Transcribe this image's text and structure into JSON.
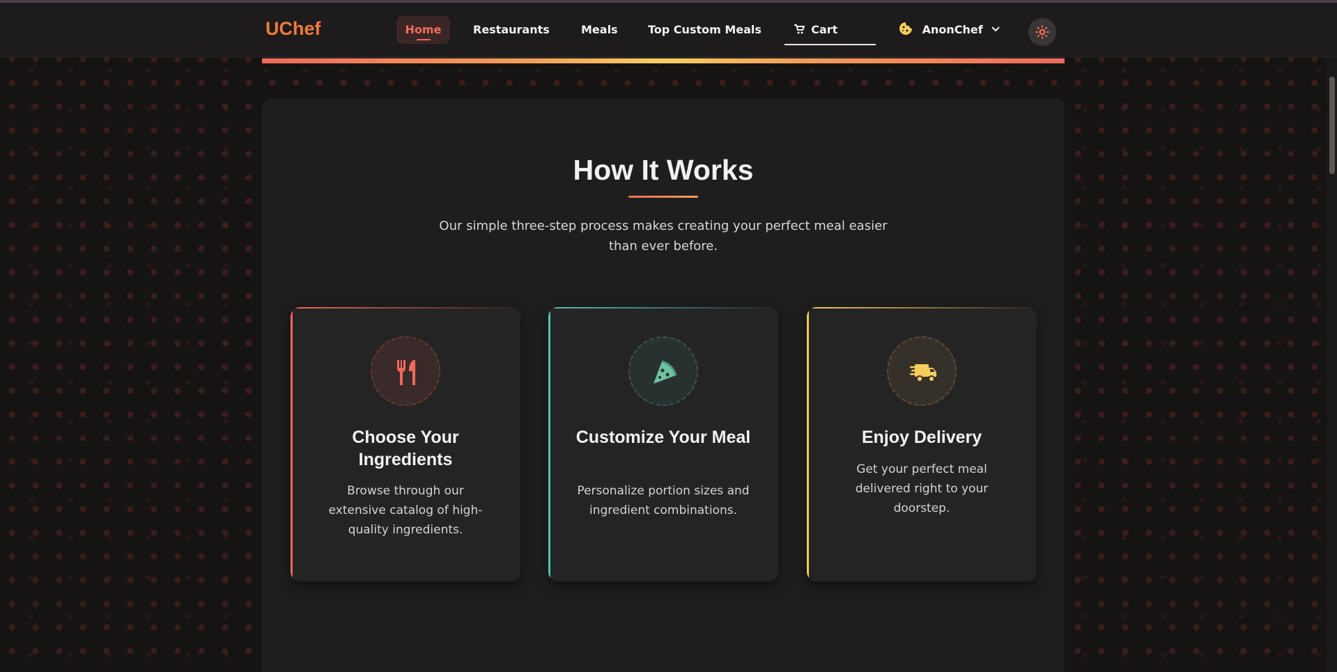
{
  "navbar": {
    "logo": "UChef",
    "links": [
      {
        "label": "Home"
      },
      {
        "label": "Restaurants"
      },
      {
        "label": "Meals"
      },
      {
        "label": "Top Custom Meals"
      }
    ],
    "cart_label": "Cart",
    "cart_icon": "cart-icon",
    "user": {
      "name": "AnonChef",
      "icon": "cookie-icon"
    },
    "theme_toggle_icon": "sun-icon"
  },
  "section": {
    "title": "How It Works",
    "subtitle": "Our simple three-step process makes creating your perfect meal easier than ever before.",
    "cards": [
      {
        "icon": "utensils-icon",
        "title": "Choose Your Ingredients",
        "text": "Browse through our extensive catalog of high-quality ingredients."
      },
      {
        "icon": "pizza-slice-icon",
        "title": "Customize Your Meal",
        "text": "Personalize portion sizes and ingredient combinations."
      },
      {
        "icon": "delivery-truck-icon",
        "title": "Enjoy Delivery",
        "text": "Get your perfect meal delivered right to your doorstep."
      }
    ]
  },
  "colors": {
    "brand": "#f07b3c",
    "accent_red": "#f06a5a",
    "accent_teal": "#4fc7b8",
    "accent_yellow": "#f6cc5c",
    "background": "#161313"
  }
}
